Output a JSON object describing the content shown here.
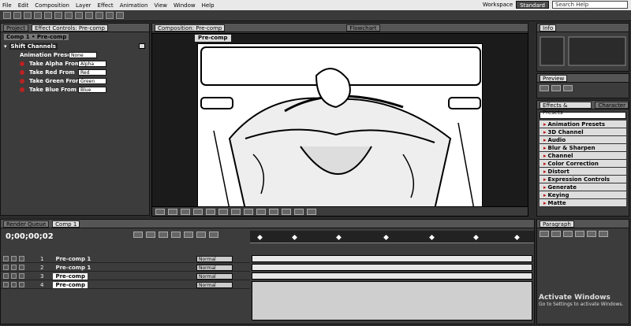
{
  "menu": [
    "File",
    "Edit",
    "Composition",
    "Layer",
    "Effect",
    "Animation",
    "View",
    "Window",
    "Help"
  ],
  "workspace": {
    "label": "Workspace",
    "value": "Standard"
  },
  "search": {
    "placeholder": "Search Help"
  },
  "left_panel": {
    "tabs": [
      "Project",
      "Effect Controls: Pre-comp"
    ],
    "breadcrumb": "Comp 1 • Pre-comp",
    "effect_name": "Shift Channels",
    "properties": [
      {
        "label": "Animation Presets",
        "value": "None"
      },
      {
        "label": "Take Alpha From",
        "value": "Alpha"
      },
      {
        "label": "Take Red From",
        "value": "Red"
      },
      {
        "label": "Take Green From",
        "value": "Green"
      },
      {
        "label": "Take Blue From",
        "value": "Blue"
      }
    ]
  },
  "viewer": {
    "tabs": [
      "Composition: Pre-comp",
      "Flowchart"
    ],
    "sub_tab": "Pre-comp"
  },
  "info_panel": {
    "label": "Info"
  },
  "preview_panel": {
    "label": "Preview"
  },
  "effects_panel": {
    "tabs": [
      "Effects & Presets",
      "Character"
    ],
    "search": "",
    "items": [
      "Animation Presets",
      "3D Channel",
      "Audio",
      "Blur & Sharpen",
      "Channel",
      "Color Correction",
      "Distort",
      "Expression Controls",
      "Generate",
      "Keying",
      "Matte"
    ]
  },
  "paragraph_panel": {
    "label": "Paragraph"
  },
  "timeline": {
    "tabs": [
      "Render Queue",
      "Comp 1"
    ],
    "timecode": "0;00;00;02",
    "layers": [
      {
        "num": "1",
        "name": "Pre-comp 1",
        "mode": "Normal"
      },
      {
        "num": "2",
        "name": "Pre-comp 1",
        "mode": "Normal"
      },
      {
        "num": "3",
        "name": "Pre-comp",
        "mode": "Normal"
      },
      {
        "num": "4",
        "name": "Pre-comp",
        "mode": "Normal"
      }
    ]
  },
  "watermark": {
    "title": "Activate Windows",
    "subtitle": "Go to Settings to activate Windows."
  }
}
